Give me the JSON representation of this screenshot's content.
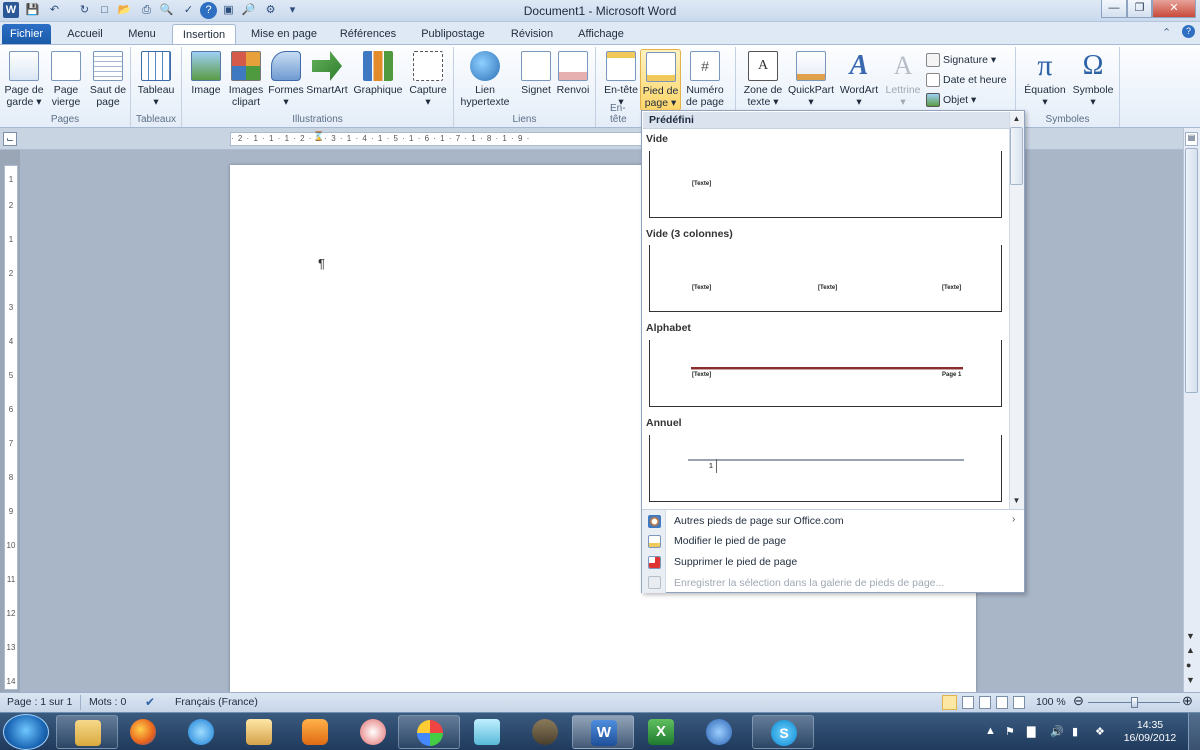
{
  "window": {
    "title": "Document1 - Microsoft Word"
  },
  "tabs": [
    {
      "label": "Fichier"
    },
    {
      "label": "Accueil"
    },
    {
      "label": "Menu"
    },
    {
      "label": "Insertion"
    },
    {
      "label": "Mise en page"
    },
    {
      "label": "Références"
    },
    {
      "label": "Publipostage"
    },
    {
      "label": "Révision"
    },
    {
      "label": "Affichage"
    }
  ],
  "active_tab": "Insertion",
  "ribbon": {
    "groups": {
      "pages": "Pages",
      "tableaux": "Tableaux",
      "illustrations": "Illustrations",
      "liens": "Liens",
      "entete": "En-tête",
      "symboles": "Symboles"
    },
    "buttons": {
      "page_de_garde": [
        "Page de",
        "garde"
      ],
      "page_vierge": [
        "Page",
        "vierge"
      ],
      "saut_de_page": [
        "Saut de",
        "page"
      ],
      "tableau": "Tableau",
      "image": "Image",
      "images_clipart": [
        "Images",
        "clipart"
      ],
      "formes": "Formes",
      "smartart": "SmartArt",
      "graphique": "Graphique",
      "capture": "Capture",
      "lien_hypertexte": [
        "Lien",
        "hypertexte"
      ],
      "signet": "Signet",
      "renvoi": "Renvoi",
      "en_tete": "En-tête",
      "pied_de_page": [
        "Pied de",
        "page"
      ],
      "numero_de_page": [
        "Numéro",
        "de page"
      ],
      "zone_de_texte": [
        "Zone de",
        "texte"
      ],
      "quickpart": "QuickPart",
      "wordart": "WordArt",
      "lettrine": "Lettrine",
      "signature": "Signature",
      "date_et_heure": "Date et heure",
      "objet": "Objet",
      "equation": "Équation",
      "symbole": "Symbole"
    }
  },
  "ruler": {
    "horizontal": "· 2 · 1 · 1 · 1 · 2 · 1 · 3 · 1 · 4 · 1 · 5 · 1 · 6 · 1 · 7 · 1 · 8 · 1 · 9 ·",
    "vertical": [
      "1",
      "2",
      "1",
      "2",
      "3",
      "4",
      "5",
      "6",
      "7",
      "8",
      "9",
      "10",
      "11",
      "12",
      "13",
      "14"
    ]
  },
  "document": {
    "pilcrow": "¶"
  },
  "dropdown": {
    "header": "Prédéfini",
    "gallery": [
      {
        "label": "Vide",
        "placeholders": [
          "[Texte]"
        ]
      },
      {
        "label": "Vide (3 colonnes)",
        "placeholders": [
          "[Texte]",
          "[Texte]",
          "[Texte]"
        ]
      },
      {
        "label": "Alphabet",
        "placeholders": [
          "[Texte]",
          "Page 1"
        ]
      },
      {
        "label": "Annuel",
        "placeholders": [
          "1"
        ]
      }
    ],
    "menu": [
      {
        "label": "Autres pieds de page sur Office.com",
        "submenu_arrow": "›",
        "enabled": true
      },
      {
        "label": "Modifier le pied de page",
        "enabled": true
      },
      {
        "label": "Supprimer le pied de page",
        "enabled": true
      },
      {
        "label": "Enregistrer la sélection dans la galerie de pieds de page...",
        "enabled": false
      }
    ]
  },
  "statusbar": {
    "page": "Page : 1 sur 1",
    "words": "Mots : 0",
    "language": "Français (France)",
    "zoom": "100 %"
  },
  "taskbar": {
    "time": "14:35",
    "date": "16/09/2012"
  },
  "colors": {
    "file_tab": "#1a5aa8",
    "highlight": "#fdd66a",
    "alphabet_line": "#8b2d2d"
  }
}
